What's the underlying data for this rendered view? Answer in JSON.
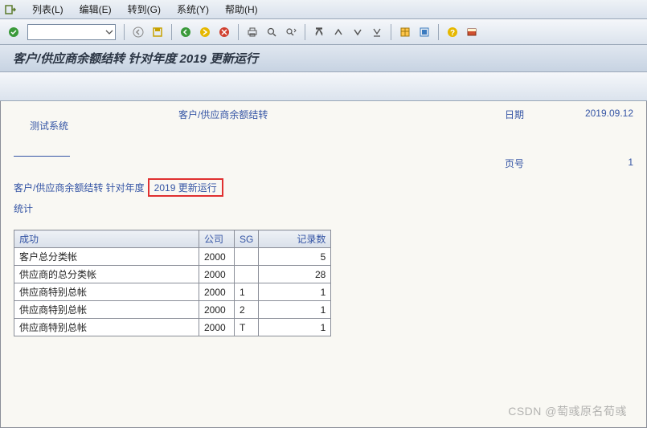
{
  "menu": {
    "items": [
      "列表(L)",
      "编辑(E)",
      "转到(G)",
      "系统(Y)",
      "帮助(H)"
    ]
  },
  "title": "客户/供应商余额结转 针对年度 2019 更新运行",
  "header": {
    "test_system_label": "测试系统",
    "center_text": "客户/供应商余额结转",
    "date_label": "日期",
    "date_value": "2019.09.12",
    "page_label": "页号",
    "page_value": "1",
    "line2_left": "客户/供应商余额结转 针对年度",
    "line2_highlight": "2019 更新运行",
    "statistics_label": "统计"
  },
  "table": {
    "columns": [
      "成功",
      "公司",
      "SG",
      "记录数"
    ],
    "rows": [
      {
        "name": "客户总分类帐",
        "company": "2000",
        "sg": "",
        "count": "5"
      },
      {
        "name": "供应商的总分类帐",
        "company": "2000",
        "sg": "",
        "count": "28"
      },
      {
        "name": "供应商特别总帐",
        "company": "2000",
        "sg": "1",
        "count": "1"
      },
      {
        "name": "供应商特别总帐",
        "company": "2000",
        "sg": "2",
        "count": "1"
      },
      {
        "name": "供应商特别总帐",
        "company": "2000",
        "sg": "T",
        "count": "1"
      }
    ]
  },
  "watermark": "CSDN @萄彧原名荀彧"
}
